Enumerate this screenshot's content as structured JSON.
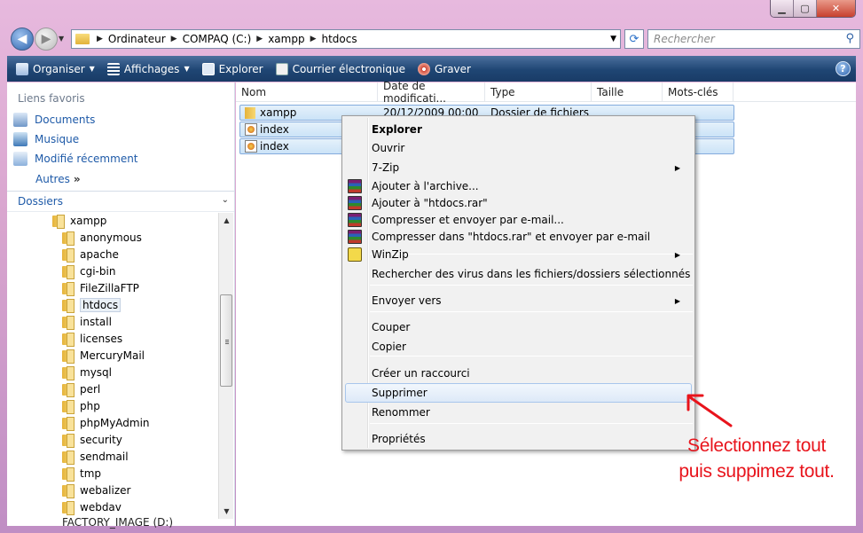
{
  "window": {
    "controls": [
      "minimize",
      "maximize",
      "close"
    ]
  },
  "nav": {
    "breadcrumb": [
      "Ordinateur",
      "COMPAQ (C:)",
      "xampp",
      "htdocs"
    ],
    "search_placeholder": "Rechercher"
  },
  "toolbar": {
    "organize": "Organiser",
    "views": "Affichages",
    "explore": "Explorer",
    "email": "Courrier électronique",
    "burn": "Graver"
  },
  "sidebar": {
    "favorites_header": "Liens favoris",
    "favorites": [
      "Documents",
      "Musique",
      "Modifié récemment"
    ],
    "more": "Autres",
    "folders_header": "Dossiers",
    "tree": {
      "root": "xampp",
      "children": [
        "anonymous",
        "apache",
        "cgi-bin",
        "FileZillaFTP",
        "htdocs",
        "install",
        "licenses",
        "MercuryMail",
        "mysql",
        "perl",
        "php",
        "phpMyAdmin",
        "security",
        "sendmail",
        "tmp",
        "webalizer",
        "webdav"
      ],
      "selected": "htdocs",
      "cut_off": "FACTORY_IMAGE (D:)"
    }
  },
  "columns": [
    "Nom",
    "Date de modificati...",
    "Type",
    "Taille",
    "Mots-clés"
  ],
  "files": [
    {
      "name": "xampp",
      "date": "20/12/2009 00:00",
      "type": "Dossier de fichiers",
      "icon": "folder-icon"
    },
    {
      "name": "index",
      "icon": "html-file-icon"
    },
    {
      "name": "index",
      "icon": "html-file-icon"
    }
  ],
  "context_menu": {
    "items": [
      {
        "label": "Explorer",
        "bold": true
      },
      {
        "label": "Ouvrir"
      },
      {
        "label": "7-Zip",
        "submenu": true
      },
      {
        "label": "Ajouter à l'archive...",
        "icon": "winrar-icon"
      },
      {
        "label": "Ajouter à \"htdocs.rar\"",
        "icon": "winrar-icon"
      },
      {
        "label": "Compresser et envoyer par e-mail...",
        "icon": "winrar-icon"
      },
      {
        "label": "Compresser dans \"htdocs.rar\" et envoyer par e-mail",
        "icon": "winrar-icon"
      },
      {
        "label": "WinZip",
        "submenu": true,
        "icon": "winzip-icon"
      },
      {
        "label": "Rechercher des virus dans les fichiers/dossiers sélectionnés"
      },
      {
        "label": "Envoyer vers",
        "submenu": true
      },
      {
        "label": "Couper"
      },
      {
        "label": "Copier"
      },
      {
        "label": "Créer un raccourci"
      },
      {
        "label": "Supprimer",
        "highlighted": true
      },
      {
        "label": "Renommer"
      },
      {
        "label": "Propriétés"
      }
    ]
  },
  "annotation": {
    "line1": "Sélectionnez tout",
    "line2": "puis suppimez tout.",
    "color": "#e8141c"
  }
}
